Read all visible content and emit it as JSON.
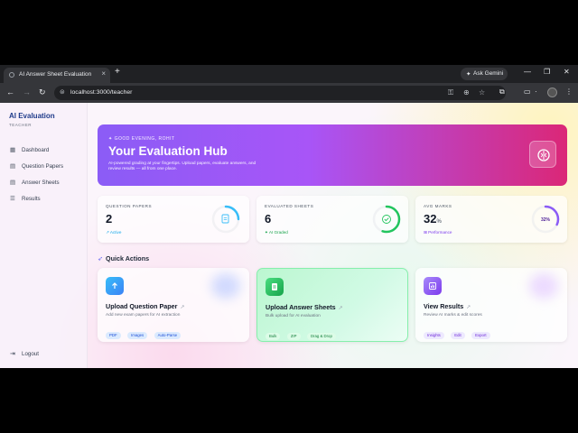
{
  "browser": {
    "tab_title": "AI Answer Sheet Evaluation",
    "gemini_label": "Ask Gemini",
    "url": "localhost:3000/teacher"
  },
  "sidebar": {
    "brand": "AI Evaluation",
    "role": "TEACHER",
    "items": [
      {
        "label": "Dashboard",
        "icon": "grid-icon"
      },
      {
        "label": "Question Papers",
        "icon": "document-icon"
      },
      {
        "label": "Answer Sheets",
        "icon": "document-icon"
      },
      {
        "label": "Results",
        "icon": "list-icon"
      }
    ],
    "logout": "Logout"
  },
  "hero": {
    "greeting": "GOOD EVENING, ROHIT",
    "title": "Your Evaluation Hub",
    "subtitle": "AI-powered grading at your fingertips. Upload papers, evaluate answers, and review results — all from one place."
  },
  "stats": [
    {
      "label": "QUESTION PAPERS",
      "value": "2",
      "unit": "",
      "tag": "↗ Active",
      "color": "#38bdf8",
      "progress": 0.25
    },
    {
      "label": "EVALUATED SHEETS",
      "value": "6",
      "unit": "",
      "tag": "✦ AI Graded",
      "color": "#22c55e",
      "progress": 0.55
    },
    {
      "label": "AVG MARKS",
      "value": "32",
      "unit": "%",
      "tag": "⊞ Performance",
      "color": "#8b5cf6",
      "progress": 0.32,
      "ring_label": "32%"
    }
  ],
  "quick_actions": {
    "title": "Quick Actions",
    "cards": [
      {
        "title": "Upload Question Paper",
        "desc": "Add new exam papers for AI extraction",
        "chips": [
          "PDF",
          "Images",
          "Auto-Parse"
        ],
        "color": "#3b82f6"
      },
      {
        "title": "Upload Answer Sheets",
        "desc": "Bulk upload for AI evaluation",
        "chips": [
          "Bulk",
          "ZIP",
          "Drag & Drop"
        ],
        "color": "#22c55e"
      },
      {
        "title": "View Results",
        "desc": "Review AI marks & edit scores",
        "chips": [
          "Insights",
          "Edit",
          "Export"
        ],
        "color": "#8b5cf6"
      }
    ]
  }
}
